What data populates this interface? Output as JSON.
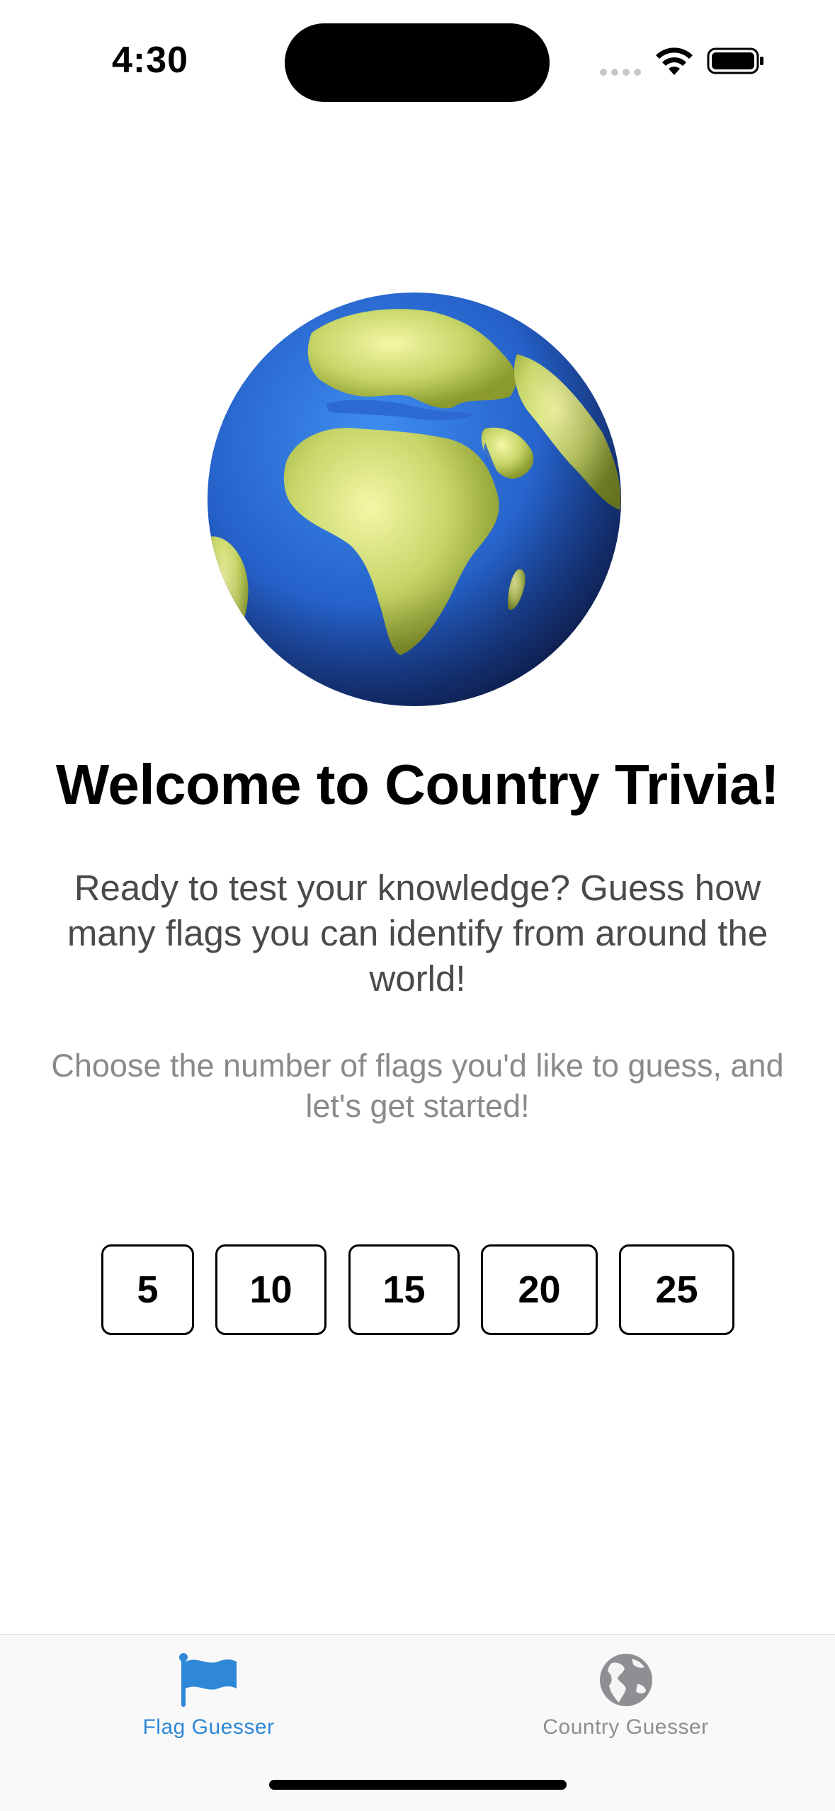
{
  "status_bar": {
    "time": "4:30"
  },
  "hero": {
    "image_icon": "globe-europe-africa-emoji"
  },
  "welcome": {
    "title": "Welcome to Country Trivia!",
    "intro": "Ready to test your knowledge? Guess how many flags you can identify from around the world!",
    "instruction": "Choose the number of flags you'd like to guess, and let's get started!"
  },
  "choices": [
    "5",
    "10",
    "15",
    "20",
    "25"
  ],
  "tab_bar": {
    "tabs": [
      {
        "label": "Flag Guesser",
        "icon": "flag-icon",
        "active": true
      },
      {
        "label": "Country Guesser",
        "icon": "globe-icon",
        "active": false
      }
    ]
  },
  "colors": {
    "accent": "#2f88d7",
    "inactive": "#8e8e93",
    "intro_text": "#4a4a4a",
    "instruction_text": "#8a8a8a"
  }
}
